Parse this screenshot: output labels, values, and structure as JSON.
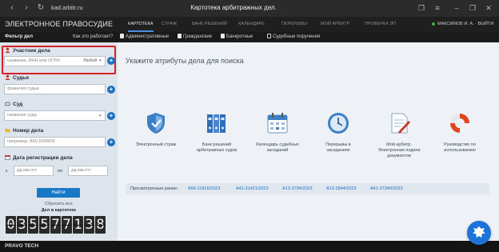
{
  "browser": {
    "url": "kad.arbitr.ru",
    "page_title": "Картотека арбитражных дел."
  },
  "header": {
    "brand": "ЭЛЕКТРОННОЕ ПРАВОСУДИЕ",
    "nav": [
      "КАРТОТЕКА",
      "СТРАЖ",
      "БАНК РЕШЕНИЙ",
      "КАЛЕНДАРЬ",
      "ПЕРЕРЫВЫ",
      "МОЙ АРБИТР",
      "ПРОВЕРКА ЭП"
    ],
    "user": "МАКСИМОВ И. А. · ВЫЙТИ"
  },
  "filters": {
    "title": "Фильтр дел",
    "how_it_works": "Как это работает?",
    "categories": [
      "Административные",
      "Гражданские",
      "Банкротные",
      "Судебные поручения"
    ]
  },
  "sidebar": {
    "participant": {
      "label": "Участник дела",
      "placeholder": "название, ИНН или ОГРН",
      "role": "Любой"
    },
    "judge": {
      "label": "Судья",
      "placeholder": "фамилия судьи"
    },
    "court": {
      "label": "Суд",
      "placeholder": "название суда"
    },
    "case_number": {
      "label": "Номер дела",
      "placeholder": "например, А50-5568/08"
    },
    "reg_date": {
      "label": "Дата регистрации дела",
      "from": "с",
      "to": "по",
      "placeholder": "дд.мм.гггг"
    },
    "search_button": "Найти",
    "reset_link": "Сбросить все",
    "counter_label": "Дел в картотеке",
    "counter_digits": [
      "0",
      "3",
      "5",
      "5",
      "7",
      "7",
      "1",
      "3",
      "8"
    ]
  },
  "main": {
    "heading": "Укажите атрибуты дела для поиска",
    "tiles": [
      {
        "label": "Электронный страж",
        "icon": "shield-icon"
      },
      {
        "label": "Банк решений арбитражных судов",
        "icon": "binders-icon"
      },
      {
        "label": "Календарь судебных заседаний",
        "icon": "calendar-icon"
      },
      {
        "label": "Перерывы в заседаниях",
        "icon": "clock-icon"
      },
      {
        "label": "Мой арбитр. Электронная подача документов",
        "icon": "document-pen-icon"
      },
      {
        "label": "Руководство по использованию",
        "icon": "lifebuoy-icon"
      }
    ],
    "recent_label": "Просмотренные ранее:",
    "recent_cases": [
      "А56-11816/2023",
      "А41-31421/2023",
      "А13-3794/2023",
      "А13-2844/2023",
      "А41-37340/2023"
    ]
  },
  "footer": {
    "brand": "PRAVO TECH"
  },
  "colors": {
    "accent": "#1d6fc2",
    "highlight": "#d61f26",
    "header_bg": "#1f1f1f",
    "sidebar_bg": "#dde4ec",
    "main_bg": "#eef2f6"
  }
}
